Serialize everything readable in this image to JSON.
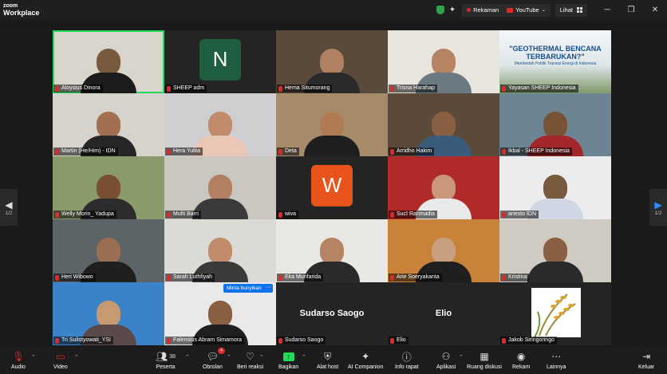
{
  "app": {
    "logo_line1": "zoom",
    "logo_line2": "Workplace"
  },
  "topbar": {
    "recording_label": "Rekaman",
    "youtube_label": "YouTube",
    "view_label": "Lihat",
    "minimize": "─",
    "restore": "❐",
    "close": "✕"
  },
  "pagination": {
    "left": "1/2",
    "right": "1/2"
  },
  "tiles": [
    {
      "name": "Aloysius Dinora",
      "type": "video",
      "bg": "#d9d4cc",
      "skin": "#7a5a3e",
      "shirt": "#1c1c1c",
      "active": true
    },
    {
      "name": "SHEEP adm",
      "type": "initial",
      "initial": "N",
      "color": "#1f5f3f"
    },
    {
      "name": "Hema Situmorang",
      "type": "video",
      "bg": "#5a4a3c",
      "skin": "#b08062",
      "shirt": "#2a2a2a"
    },
    {
      "name": "Trisna Harahap",
      "type": "video",
      "bg": "#e8e4de",
      "skin": "#b58463",
      "shirt": "#6a7a80"
    },
    {
      "name": "Yayasan SHEEP Indonesia",
      "type": "poster",
      "title": "\"GEOTHERMAL BENCANA TERBARUKAN?\"",
      "subtitle": "Membedah Politik Transisi Energi di Indonesia"
    },
    {
      "name": "Martin (He/Him) - IDN",
      "type": "video",
      "bg": "#d6d2cc",
      "skin": "#a07050",
      "shirt": "#262626"
    },
    {
      "name": "Hera Yulita",
      "type": "video",
      "bg": "#cfcfd2",
      "skin": "#c08c6c",
      "shirt": "#e9c6b6"
    },
    {
      "name": "Deta",
      "type": "video",
      "bg": "#a58b6a",
      "skin": "#b07a55",
      "shirt": "#1f1f1f"
    },
    {
      "name": "Arridho Hakim",
      "type": "video",
      "bg": "#5b4a3a",
      "skin": "#8a5f42",
      "shirt": "#3a5b7a"
    },
    {
      "name": "Ikbal - SHEEP Indonesia",
      "type": "video",
      "bg": "#6d8592",
      "skin": "#7a5336",
      "shirt": "#a3262a"
    },
    {
      "name": "Welly Morin_ Yadupa",
      "type": "video",
      "bg": "#8a9a6a",
      "skin": "#7a4e32",
      "shirt": "#2c2c2c"
    },
    {
      "name": "Mufti Barri",
      "type": "video",
      "bg": "#c9c7c0",
      "skin": "#b08060",
      "shirt": "#3a3a3a"
    },
    {
      "name": "wiva",
      "type": "initial",
      "initial": "W",
      "color": "#e8541c"
    },
    {
      "name": "Sucī Rahmadia",
      "type": "video",
      "bg": "#b02a2a",
      "skin": "#c99878",
      "shirt": "#e9e9e9"
    },
    {
      "name": "ariesto IDN",
      "type": "video",
      "bg": "#ececec",
      "skin": "#7a5a3e",
      "shirt": "#cfd7e4"
    },
    {
      "name": "Heri Wibowo",
      "type": "video",
      "bg": "#5d6468",
      "skin": "#9a6e50",
      "shirt": "#1f1f1f"
    },
    {
      "name": "Sarah Luthfiyah",
      "type": "video",
      "bg": "#dcdad4",
      "skin": "#c08c6c",
      "shirt": "#3a3a3a"
    },
    {
      "name": "Eka Munfarida",
      "type": "video",
      "bg": "#eae8e4",
      "skin": "#b58463",
      "shirt": "#2a2a2a"
    },
    {
      "name": "Arie Soeryakanta",
      "type": "video",
      "bg": "#c9823a",
      "skin": "#c8a080",
      "shirt": "#1f1f1f"
    },
    {
      "name": "Kristina",
      "type": "video",
      "bg": "#cfcac2",
      "skin": "#8a5f42",
      "shirt": "#2a2a2a"
    },
    {
      "name": "Tri Sulistyowati_YSI",
      "type": "video",
      "bg": "#3b83c8",
      "skin": "#c89a72",
      "shirt": "#5a4a4a"
    },
    {
      "name": "Falensius Abram Simamora",
      "type": "video",
      "bg": "#e9e9e9",
      "skin": "#8a5f42",
      "shirt": "#1f1f1f",
      "hover": true
    },
    {
      "name": "Sudarso Saogo",
      "type": "text"
    },
    {
      "name": "Elio",
      "type": "text"
    },
    {
      "name": "Jakob Siringoringo",
      "type": "rice"
    }
  ],
  "hover": {
    "request_unmute": "Minta bunyikan",
    "more": "···"
  },
  "toolbar": {
    "audio": "Audio",
    "video": "Video",
    "participants": "Peserta",
    "participants_count": "38",
    "chat": "Obrolan",
    "chat_badge": "4",
    "reactions": "Beri reaksi",
    "share": "Bagikan",
    "host_tools": "Alat host",
    "ai_companion": "AI Companion",
    "meeting_info": "Info rapat",
    "apps": "Aplikasi",
    "breakout": "Ruang diskusi",
    "record": "Rekam",
    "more": "Lainnya",
    "leave": "Keluar"
  }
}
